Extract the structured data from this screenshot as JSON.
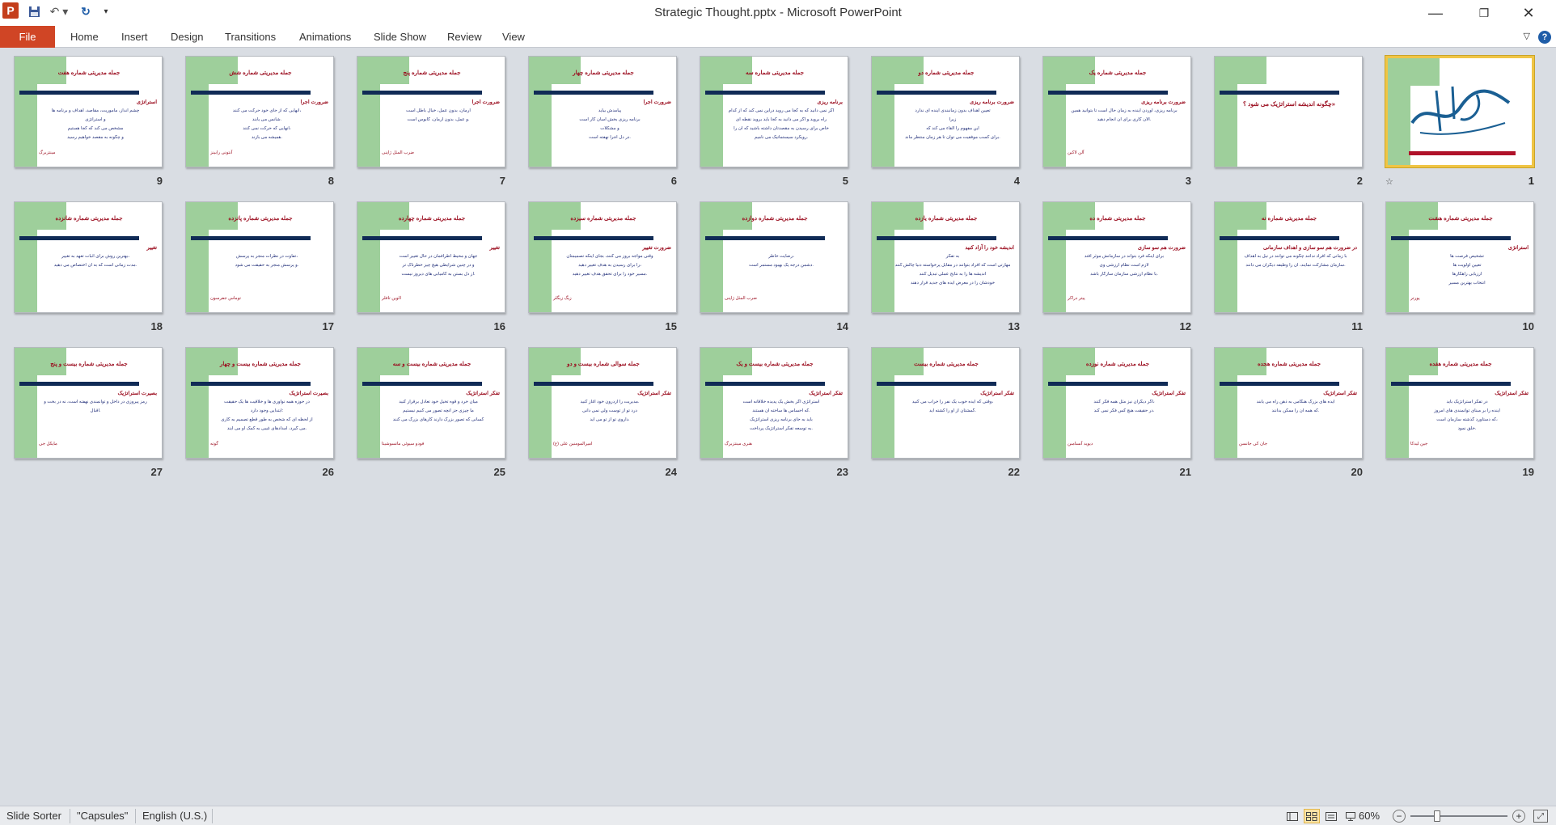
{
  "window": {
    "title": "Strategic Thought.pptx  -  Microsoft PowerPoint",
    "minimize": "—",
    "restore": "❐",
    "close": "✕"
  },
  "quick_access": {
    "app": "P",
    "save": "💾",
    "undo": "↶ ▾",
    "redo": "↻",
    "more": "▾"
  },
  "ribbon": {
    "file": "File",
    "tabs": [
      "Home",
      "Insert",
      "Design",
      "Transitions",
      "Animations",
      "Slide Show",
      "Review",
      "View"
    ],
    "minimize_ribbon": "▽",
    "help": "?"
  },
  "colors": {
    "file_tab": "#d04525",
    "accent_green": "#9ecf9b",
    "accent_navy": "#102b56",
    "title_red": "#9b0d1f",
    "selected_border": "#f0c545"
  },
  "slides": [
    {
      "num": "1",
      "selected": true,
      "star": "☆",
      "title": "",
      "sub": "",
      "lines": [],
      "author": ""
    },
    {
      "num": "2",
      "title": "",
      "sub": "چگونه اندیشه استراتژیک می شود ؟»",
      "lines": [],
      "author": ""
    },
    {
      "num": "3",
      "title": "جمله مدیریتی شماره یک",
      "sub": "ضرورت برنامه ریزی",
      "lines": [
        "برنامه ریزی، آوردن آینده به زمان حال است تا بتوانید همین",
        "الان کاری برای آن انجام دهید."
      ],
      "author": "آلن لاکین"
    },
    {
      "num": "4",
      "title": "جمله مدیریتی شماره دو",
      "sub": "ضرورت برنامه ریزی",
      "lines": [
        "تعیین اهداف بدون زمانبندی آینده ای ندارد",
        "زیرا",
        "این مفهوم را القاء می کند که",
        "برای کسب موفقیت می توان تا هر زمان منتظر ماند."
      ],
      "author": ""
    },
    {
      "num": "5",
      "title": "جمله مدیریتی شماره سه",
      "sub": "برنامه ریزی",
      "lines": [
        "اگر نمی دانید که به کجا می روید دراین نمی کند که از کدام",
        "راه بروید.و اگر می دانید به کجا باید بروید نقطه ای",
        "خاص برای رسیدن به مقصدتان داشته باشید که آن را",
        "رویکرد سیستماتیک می نامیم."
      ],
      "author": ""
    },
    {
      "num": "6",
      "title": "جمله مدیریتی شماره چهار",
      "sub": "ضرورت اجرا",
      "lines": [
        "پیامدش بیاید",
        "برنامه ریزی بخش آسان کار است",
        "و مشکلات",
        "در دل اجرا نهفته است."
      ],
      "author": ""
    },
    {
      "num": "7",
      "title": "جمله مدیریتی شماره پنج",
      "sub": "ضرورت اجرا",
      "lines": [
        "آرمان، بدون عمل، خیال باطل است",
        "و عمل، بدون آرمان، کابوس است."
      ],
      "author": "ضرب المثل ژاپنی"
    },
    {
      "num": "8",
      "title": "جمله مدیریتی شماره شش",
      "sub": "ضرورت اجرا",
      "lines": [
        "آنهایی که از جای خود حرکت می کنند،",
        "شانس می یابند.",
        "آنهایی که حرکت نمی کنند،",
        "همیشه می بازند."
      ],
      "author": "آنتونی رابینز"
    },
    {
      "num": "9",
      "title": "جمله مدیریتی شماره هفت",
      "sub": "استراتژی",
      "lines": [
        "چشم انداز، مأموریت، مقاصد، اهداف و برنامه ها",
        "و استراتژی",
        "مشخص می کند که کجا هستیم",
        "و چگونه به مقصد خواهیم رسید"
      ],
      "author": "مینتزبرگ"
    },
    {
      "num": "10",
      "title": "جمله مدیریتی شماره هشت",
      "sub": "استراتژی",
      "lines": [
        "تشخیص فرصت ها",
        "تعیین اولویت ها",
        "ارزیابی راهکارها",
        "انتخاب بهترین مسیر"
      ],
      "author": "پورتر"
    },
    {
      "num": "11",
      "title": "جمله مدیریتی شماره نه",
      "sub": "در ضرورت هم سو سازی و اهداف سازمانی",
      "lines": [
        "با زمانی که افراد ندانند چگونه می توانند در نیل به اهداف",
        "سازمان مشارکت نمایند، آن را وظیفه دیگران می دانند."
      ],
      "author": ""
    },
    {
      "num": "12",
      "title": "جمله مدیریتی شماره ده",
      "sub": "ضرورت هم سو سازی",
      "lines": [
        "برای اینکه فرد بتواند در سازمانش موثر افتد",
        "لازم است نظام ارزشی وی",
        "با نظام ارزشی سازمان سازگار باشد."
      ],
      "author": "پیتر دراکر"
    },
    {
      "num": "13",
      "title": "جمله مدیریتی شماره یازده",
      "sub": "اندیشه خود را آزاد کنید",
      "lines": [
        "به تفکر",
        "مهارتی است که افراد بتوانند در مقابل پرخواسته دنیا چالش کنند",
        "اندیشه ها را به نتایج عملی تبدیل کنند",
        "خودشان را در معرض ایده های جدید قرار دهند"
      ],
      "author": ""
    },
    {
      "num": "14",
      "title": "جمله مدیریتی شماره دوازده",
      "sub": "",
      "lines": [
        "رضایت خاطر،",
        "دشمن درجه یک بهبود مستمر است."
      ],
      "author": "ضرب المثل ژاپنی"
    },
    {
      "num": "15",
      "title": "جمله مدیریتی شماره سیزده",
      "sub": "ضرورت تغییر",
      "lines": [
        "وقتی مواجه بروز می کنند، بجای اینکه تصمیمتان",
        "را برای رسیدن به هدف تغییر دهید،",
        "مسیر خود را برای تحقق هدف تغییر دهید."
      ],
      "author": "زیگ زیگلر"
    },
    {
      "num": "16",
      "title": "جمله مدیریتی شماره چهارده",
      "sub": "تغییر",
      "lines": [
        "جهان و محیط اطرافمان در حال تغییر است",
        "و در چنین شرایطی هیچ چیز خطرناک تر",
        "از دل بستن به کامیابی های دیروز نیست."
      ],
      "author": "الوین تافلر"
    },
    {
      "num": "17",
      "title": "جمله مدیریتی شماره پانزده",
      "sub": "",
      "lines": [
        "تفاوت در نظرات منجر به پرسش،",
        "و پرسش منجر به حقیقت می شود."
      ],
      "author": "توماس جفرسون"
    },
    {
      "num": "18",
      "title": "جمله مدیریتی شماره شانزده",
      "sub": "تغییر",
      "lines": [
        "بهترین روش برای اثبات تعهد به تغییر،",
        "مدت زمانی است که به آن اختصاص می دهید."
      ],
      "author": ""
    },
    {
      "num": "19",
      "title": "جمله مدیریتی شماره هفده",
      "sub": "تفکر استراتژیک",
      "lines": [
        "در تفکر استراتژیک باید",
        "آینده را بر مبنای توانمندی های امروز",
        "که دستاورد گذشته سازمان است،",
        "خلق نمود."
      ],
      "author": "جین لیدکا"
    },
    {
      "num": "20",
      "title": "جمله مدیریتی شماره هجده",
      "sub": "تفکر استراتژیک",
      "lines": [
        "ایده های بزرگ هنگامی به ذهن راه می یابند",
        "که همه آن را ممکن بدانند."
      ],
      "author": "جان کی جانسن"
    },
    {
      "num": "21",
      "title": "جمله مدیریتی شماره نوزده",
      "sub": "تفکر استراتژیک",
      "lines": [
        "اگر دیگران نیز مثل همه فکر کنند،",
        "در حقیقت هیچ کس فکر نمی کند."
      ],
      "author": "دیوید آنسامبن"
    },
    {
      "num": "22",
      "title": "جمله مدیریتی شماره بیست",
      "sub": "تفکر استراتژیک",
      "lines": [
        "وقتی که ایده خوب یک نفر را خراب می کنید،",
        "گمشتان از او را کشته اید."
      ],
      "author": ""
    },
    {
      "num": "23",
      "title": "جمله مدیریتی شماره بیست و یک",
      "sub": "تفکر استراتژیک",
      "lines": [
        "استراتژی اگر بخش یک پدیده خلاقانه است",
        "که احساس ها ساخته آن هستند.",
        "باید به جای برنامه ریزی استراتژیک",
        "به توسعه تفکر استراتژیک پرداخت."
      ],
      "author": "هنری مینتزبرگ"
    },
    {
      "num": "24",
      "title": "جمله سوالی شماره بیست و دو",
      "sub": "تفکر استراتژیک",
      "lines": [
        "مدیریت را ازدرون خود آغاز کنید.",
        "درد تو از توست ولی نمی دانی",
        "داروی تو از تو می آید."
      ],
      "author": "امیرالمومنین علی (ع)"
    },
    {
      "num": "25",
      "title": "جمله مدیریتی شماره بیست و سه",
      "sub": "تفکر استراتژیک",
      "lines": [
        "میان خرد و قوه تخیل خود تعادل برقرار کنید",
        "ما چیزی جز آنچه تصور می کنیم نیستیم",
        "کسانی که تصور بزرگ دارند کارهای بزرگ می کنند"
      ],
      "author": "فودو سیوئی ماتسوشیتا"
    },
    {
      "num": "26",
      "title": "جمله مدیریتی شماره بیست و چهار",
      "sub": "بصیرت استراتژیک",
      "lines": [
        "در حوزه همه نوآوری ها و خلاقیت ها یک حقیقت",
        "ابتدایی وجود دارد:",
        "از لحظه ای که شخص به طور قطع تصمیم به کاری",
        "می گیرد، امدادهای غیبی به کمک او می آیند."
      ],
      "author": "گوته"
    },
    {
      "num": "27",
      "title": "جمله مدیریتی شماره بیست و پنج",
      "sub": "بصیرت استراتژیک",
      "lines": [
        "رمز پیروزی در داخل و توانمندی نهفته است، نه در بخت و",
        "اقبال."
      ],
      "author": "مایکل جی"
    }
  ],
  "status": {
    "view": "Slide Sorter",
    "theme": "\"Capsules\"",
    "language": "English (U.S.)",
    "zoom": "60%",
    "zoom_level": 60,
    "zoom_minus": "−",
    "zoom_plus": "+",
    "fit": "⤢"
  }
}
